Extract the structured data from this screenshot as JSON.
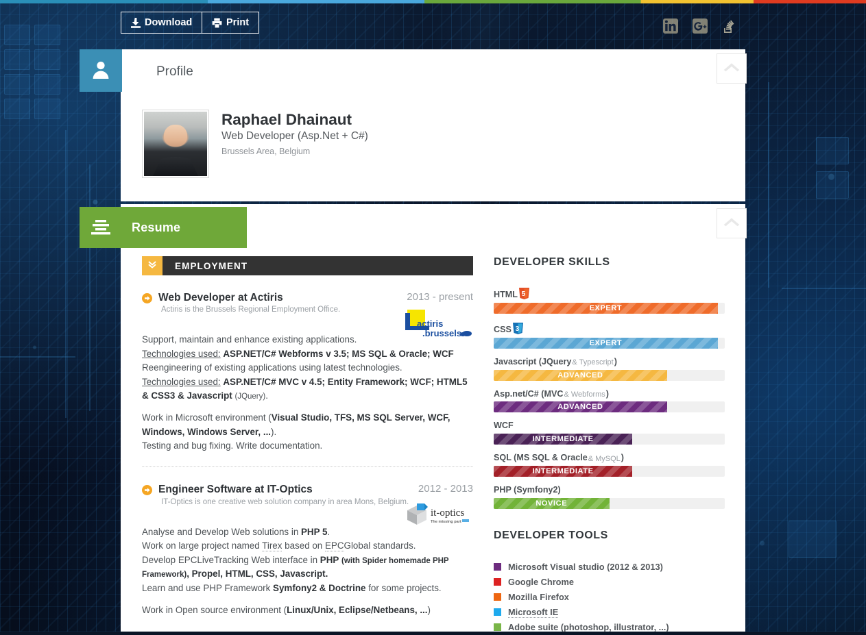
{
  "toolbar": {
    "download_label": "Download",
    "print_label": "Print",
    "download_icon": "download-icon",
    "print_icon": "printer-icon",
    "social": [
      {
        "name": "linkedin",
        "label": "in"
      },
      {
        "name": "google-plus",
        "label": "g+"
      },
      {
        "name": "stackoverflow",
        "label": "stack"
      }
    ]
  },
  "accent_colors": {
    "profile_tab": "#3b8fb5",
    "resume_tab": "#6fa839",
    "section_bar": "#333333",
    "section_toggle": "#f5b841",
    "job_arrow": "#f5a623"
  },
  "profile": {
    "section_title": "Profile",
    "icon": "user-icon",
    "name": "Raphael Dhainaut",
    "role": "Web Developer (Asp.Net + C#)",
    "location": "Brussels Area, Belgium",
    "collapse_icon": "chevron-up-icon"
  },
  "resume": {
    "section_title": "Resume",
    "icon": "list-icon",
    "collapse_icon": "chevron-up-icon",
    "employment": {
      "title": "EMPLOYMENT",
      "toggle_icon": "chevron-double-down-icon",
      "jobs": [
        {
          "title": "Web Developer at Actiris",
          "company_note": "Actiris is the Brussels Regional Employment Office.",
          "period": "2013 - present",
          "logo": "actiris-logo",
          "logo_text": "actiris",
          "logo_subtext": ".brussels"
        },
        {
          "title": "Engineer Software at IT-Optics",
          "company_note": "IT-Optics is one creative web solution company in area Mons, Belgium.",
          "period": "2012 - 2013",
          "logo": "it-optics-logo",
          "logo_text": "it-optics",
          "logo_subtext": "The missing part"
        }
      ]
    }
  },
  "skills": {
    "title": "DEVELOPER SKILLS",
    "items": [
      {
        "name": "HTML",
        "badge": "html5-badge",
        "level": "EXPERT",
        "percent": 97,
        "color": "#ef6c2b"
      },
      {
        "name": "CSS",
        "badge": "css3-badge",
        "level": "EXPERT",
        "percent": 97,
        "color": "#5ba7d4"
      },
      {
        "name": "Javascript (JQuery",
        "name_light": " & Typescript",
        "name_tail": ")",
        "level": "ADVANCED",
        "percent": 75,
        "color": "#f5b841"
      },
      {
        "name": "Asp.net/C# (MVC",
        "name_light": " & Webforms",
        "name_tail": ")",
        "level": "ADVANCED",
        "percent": 75,
        "color": "#6d2c7f"
      },
      {
        "name": "WCF",
        "level": "INTERMEDIATE",
        "percent": 60,
        "color": "#4a2256"
      },
      {
        "name": "SQL (MS SQL & Oracle",
        "name_light": " & MySQL",
        "name_tail": ")",
        "level": "INTERMEDIATE",
        "percent": 60,
        "color": "#a32028"
      },
      {
        "name": "PHP (Symfony2)",
        "level": "NOVICE",
        "percent": 50,
        "color": "#72b338"
      }
    ]
  },
  "tools": {
    "title": "DEVELOPER TOOLS",
    "items": [
      {
        "label": "Microsoft Visual studio (2012 & 2013)",
        "color": "#6d2c7f"
      },
      {
        "label": "Google Chrome",
        "color": "#dd2222"
      },
      {
        "label": "Mozilla Firefox",
        "color": "#ee6611"
      },
      {
        "label": "Microsoft IE",
        "color": "#1eaaee",
        "dotted": true
      },
      {
        "label": "Adobe suite (photoshop, illustrator, ...)",
        "color": "#7ab648"
      }
    ]
  }
}
